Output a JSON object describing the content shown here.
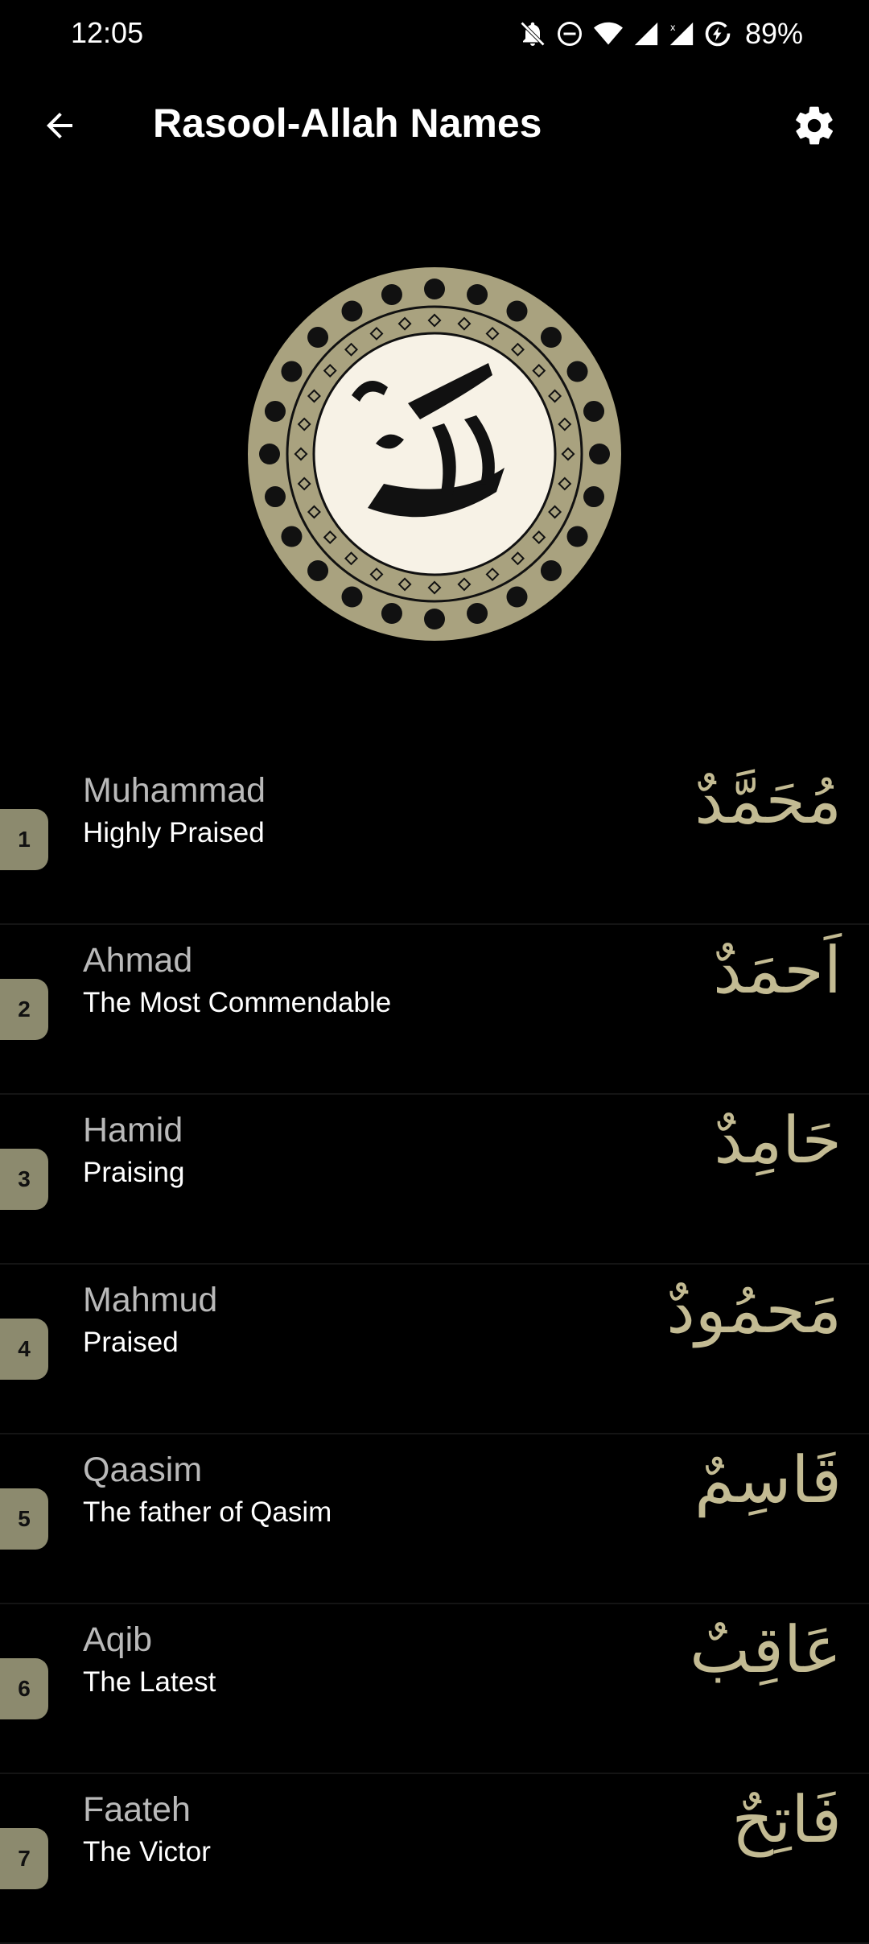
{
  "status_bar": {
    "time": "12:05",
    "battery": "89%",
    "icons": [
      "notifications-off-icon",
      "do-not-disturb-icon",
      "wifi-icon",
      "signal-icon",
      "signal-no-data-icon",
      "battery-saver-icon"
    ]
  },
  "app_bar": {
    "title": "Rasool-Allah Names",
    "back_icon": "arrow-back-icon",
    "settings_icon": "gear-icon"
  },
  "medallion": {
    "colors": {
      "ring": "#a9a27f",
      "inner": "#f7f2e6",
      "ink": "#111111"
    }
  },
  "names": [
    {
      "number": "1",
      "name": "Muhammad",
      "meaning": "Highly Praised",
      "arabic": "مُحَمَّدٌ"
    },
    {
      "number": "2",
      "name": "Ahmad",
      "meaning": "The Most Commendable",
      "arabic": "اَحمَدٌ"
    },
    {
      "number": "3",
      "name": "Hamid",
      "meaning": "Praising",
      "arabic": "حَامِدٌ"
    },
    {
      "number": "4",
      "name": "Mahmud",
      "meaning": "Praised",
      "arabic": "مَحمُودٌ"
    },
    {
      "number": "5",
      "name": "Qaasim",
      "meaning": "The father of Qasim",
      "arabic": "قَاسِمٌ"
    },
    {
      "number": "6",
      "name": "Aqib",
      "meaning": "The Latest",
      "arabic": "عَاقِبٌ"
    },
    {
      "number": "7",
      "name": "Faateh",
      "meaning": "The Victor",
      "arabic": "فَاتِحٌ"
    }
  ],
  "colors": {
    "background": "#000000",
    "badge": "#8c8a6e",
    "arabic_text": "#c3bb93",
    "name_text": "#b9b9b9"
  }
}
